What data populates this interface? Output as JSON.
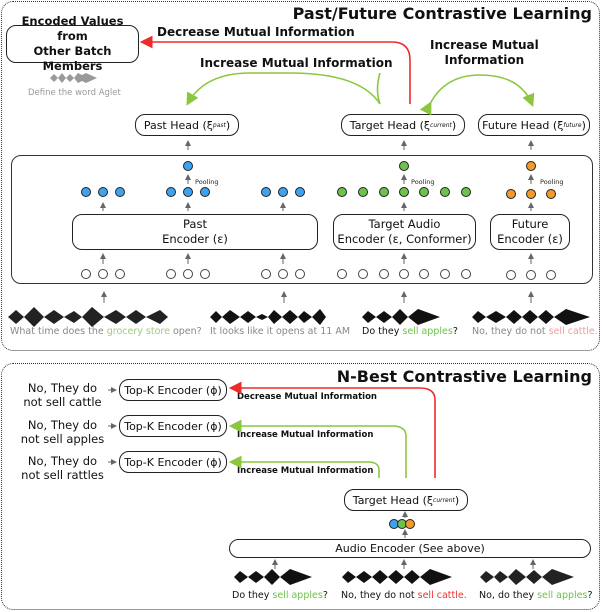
{
  "top_panel": {
    "title": "Past/Future Contrastive Learning",
    "batch_box": "Encoded Values from\nOther Batch Members",
    "batch_caption": "Define the word Aglet",
    "decrease_label": "Decrease Mutual Information",
    "increase_label_left": "Increase Mutual Information",
    "increase_label_right": "Increase Mutual\nInformation",
    "heads": {
      "past": {
        "name": "Past Head (ξ",
        "sub": "past",
        "close": ")"
      },
      "target": {
        "name": "Target Head (ξ",
        "sub": "current",
        "close": ")"
      },
      "future": {
        "name": "Future Head (ξ",
        "sub": "future",
        "close": ")"
      }
    },
    "pooling_label": "Pooling",
    "encoders": {
      "past": "Past\nEncoder (ε)",
      "target": "Target Audio\nEncoder (ε, Conformer)",
      "future": "Future\nEncoder (ε)"
    },
    "captions": [
      {
        "pre": "What time does the ",
        "hl": "grocery store",
        "post": " open?",
        "hl_color": "green",
        "style": "faded"
      },
      {
        "pre": "It looks like it opens at 11 AM",
        "hl": "",
        "post": "",
        "hl_color": "none",
        "style": "faded"
      },
      {
        "pre": "Do they ",
        "hl": "sell apples",
        "post": "?",
        "hl_color": "green",
        "style": "dark"
      },
      {
        "pre": "No, they do not ",
        "hl": "sell cattle.",
        "post": "",
        "hl_color": "red",
        "style": "faded"
      }
    ],
    "colors": {
      "past": "#3ea3ef",
      "target": "#6cc24a",
      "future": "#f39a2b",
      "decrease_arrow": "#ee2b2b",
      "increase_arrow": "#8cc63f"
    }
  },
  "bottom_panel": {
    "title": "N-Best Contrastive Learning",
    "candidates": [
      {
        "text": "No, They do\nnot sell cattle",
        "encoder": "Top-K Encoder (ϕ)",
        "relation": "Decrease Mutual Information"
      },
      {
        "text": "No, They do\nnot sell apples",
        "encoder": "Top-K Encoder (ϕ)",
        "relation": "Increase Mutual Information"
      },
      {
        "text": "No, They do\nnot sell rattles",
        "encoder": "Top-K Encoder (ϕ)",
        "relation": "Increase Mutual Information"
      }
    ],
    "target_head": {
      "name": "Target Head (ξ",
      "sub": "current",
      "close": ")"
    },
    "audio_encoder": "Audio Encoder (See above)",
    "captions": [
      {
        "pre": "Do they ",
        "hl": "sell apples",
        "post": "?",
        "hl_color": "green"
      },
      {
        "pre": "No, they do not ",
        "hl": "sell cattle.",
        "post": "",
        "hl_color": "red"
      },
      {
        "pre": "No, do they ",
        "hl": "sell apples",
        "post": "?",
        "hl_color": "green"
      }
    ]
  }
}
